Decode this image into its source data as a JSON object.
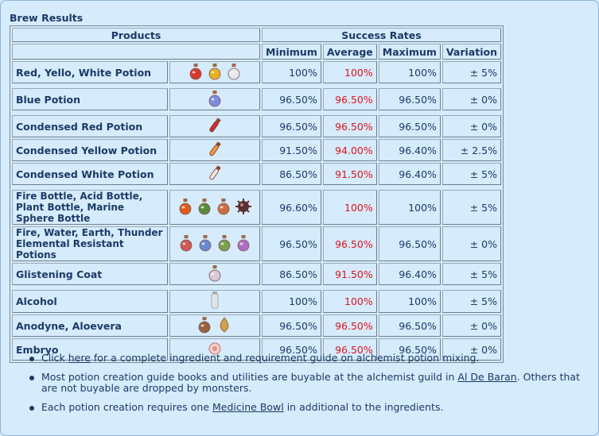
{
  "title": "Brew Results",
  "headers": {
    "products": "Products",
    "success_rates": "Success Rates",
    "minimum": "Minimum",
    "average": "Average",
    "maximum": "Maximum",
    "variation": "Variation"
  },
  "rows": [
    {
      "name": "Red, Yello, White Potion",
      "icons": [
        "red-potion-icon",
        "yellow-potion-icon",
        "white-potion-icon"
      ],
      "min": "100%",
      "avg": "100%",
      "max": "100%",
      "var": "± 5%"
    },
    {
      "name": "Blue Potion",
      "icons": [
        "blue-potion-icon"
      ],
      "min": "96.50%",
      "avg": "96.50%",
      "max": "96.50%",
      "var": "± 0%"
    },
    {
      "name": "Condensed Red Potion",
      "icons": [
        "condensed-red-potion-icon"
      ],
      "min": "96.50%",
      "avg": "96.50%",
      "max": "96.50%",
      "var": "± 0%"
    },
    {
      "name": "Condensed Yellow Potion",
      "icons": [
        "condensed-yellow-potion-icon"
      ],
      "min": "91.50%",
      "avg": "94.00%",
      "max": "96.40%",
      "var": "± 2.5%"
    },
    {
      "name": "Condensed White Potion",
      "icons": [
        "condensed-white-potion-icon"
      ],
      "min": "86.50%",
      "avg": "91.50%",
      "max": "96.40%",
      "var": "± 5%"
    },
    {
      "name": "Fire Bottle, Acid Bottle, Plant Bottle, Marine Sphere Bottle",
      "icons": [
        "fire-bottle-icon",
        "acid-bottle-icon",
        "plant-bottle-icon",
        "marine-sphere-bottle-icon"
      ],
      "min": "96.60%",
      "avg": "100%",
      "max": "100%",
      "var": "± 5%"
    },
    {
      "name": "Fire, Water, Earth, Thunder Elemental Resistant Potions",
      "icons": [
        "fire-resist-potion-icon",
        "water-resist-potion-icon",
        "earth-resist-potion-icon",
        "thunder-resist-potion-icon"
      ],
      "min": "96.50%",
      "avg": "96.50%",
      "max": "96.50%",
      "var": "± 0%"
    },
    {
      "name": "Glistening Coat",
      "icons": [
        "glistening-coat-icon"
      ],
      "min": "86.50%",
      "avg": "91.50%",
      "max": "96.40%",
      "var": "± 5%"
    },
    {
      "name": "Alcohol",
      "icons": [
        "alcohol-icon"
      ],
      "min": "100%",
      "avg": "100%",
      "max": "100%",
      "var": "± 5%"
    },
    {
      "name": "Anodyne, Aloevera",
      "icons": [
        "anodyne-icon",
        "aloevera-icon"
      ],
      "min": "96.50%",
      "avg": "96.50%",
      "max": "96.50%",
      "var": "± 0%"
    },
    {
      "name": "Embryo",
      "icons": [
        "embryo-icon"
      ],
      "min": "96.50%",
      "avg": "96.50%",
      "max": "96.50%",
      "var": "± 0%"
    }
  ],
  "notes": [
    {
      "before": "Click ",
      "link": "here",
      "after": " for a complete ingredient and requirement guide on alchemist potion mixing."
    },
    {
      "before": "Most potion creation guide books and utilities are buyable at the alchemist guild in ",
      "link": "Al De Baran",
      "after": ". Others that are not buyable are dropped by monsters."
    },
    {
      "before": "Each potion creation requires one ",
      "link": "Medicine Bowl",
      "after": " in additional to the ingredients."
    }
  ],
  "colors": {
    "average_text": "#e0141e",
    "text": "#1c3a66",
    "background": "#d6ebfb"
  }
}
